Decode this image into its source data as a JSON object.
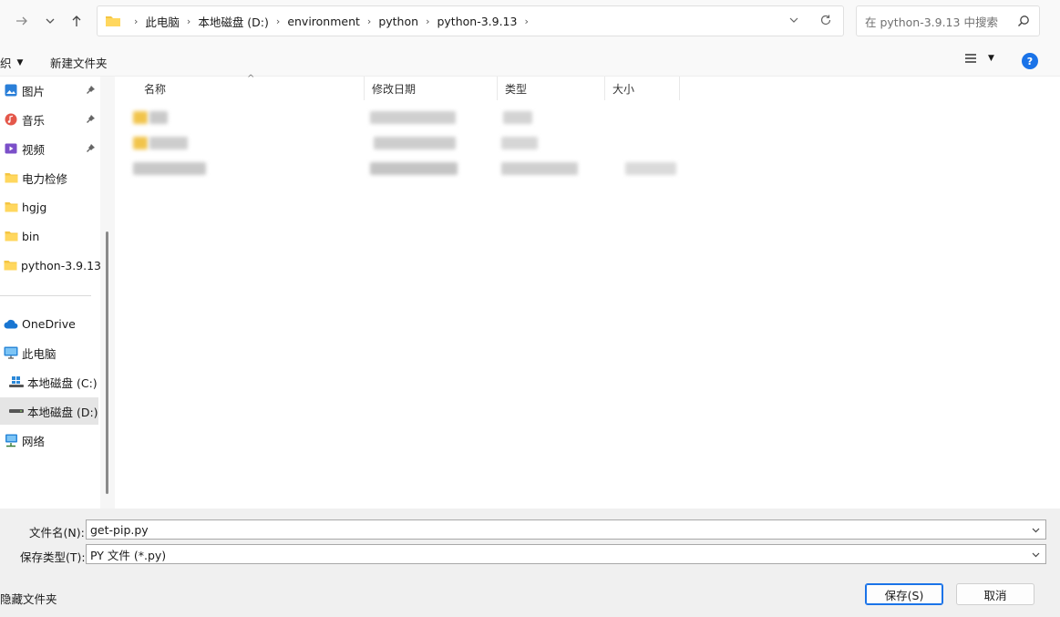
{
  "address": {
    "crumbs": [
      "此电脑",
      "本地磁盘 (D:)",
      "environment",
      "python",
      "python-3.9.13"
    ]
  },
  "search": {
    "placeholder": "在 python-3.9.13 中搜索"
  },
  "toolbar": {
    "organize": "织",
    "new_folder": "新建文件夹"
  },
  "sidebar": {
    "quick": [
      {
        "label": "图片",
        "icon": "pictures-icon",
        "pinned": true
      },
      {
        "label": "音乐",
        "icon": "music-icon",
        "pinned": true
      },
      {
        "label": "视频",
        "icon": "videos-icon",
        "pinned": true
      },
      {
        "label": "电力检修",
        "icon": "folder-icon",
        "pinned": false
      },
      {
        "label": "hgjg",
        "icon": "folder-icon",
        "pinned": false
      },
      {
        "label": "bin",
        "icon": "folder-icon",
        "pinned": false
      },
      {
        "label": "python-3.9.13",
        "icon": "folder-icon",
        "pinned": false
      }
    ],
    "onedrive": "OneDrive",
    "this_pc": "此电脑",
    "drive_c": "本地磁盘 (C:)",
    "drive_d": "本地磁盘 (D:)",
    "network": "网络"
  },
  "columns": {
    "name": "名称",
    "modified": "修改日期",
    "type": "类型",
    "size": "大小"
  },
  "bottom": {
    "filename_label": "文件名(N):",
    "filename_value": "get-pip.py",
    "filetype_label": "保存类型(T):",
    "filetype_value": "PY 文件 (*.py)",
    "hide_folders": "隐藏文件夹",
    "save": "保存(S)",
    "cancel": "取消"
  }
}
